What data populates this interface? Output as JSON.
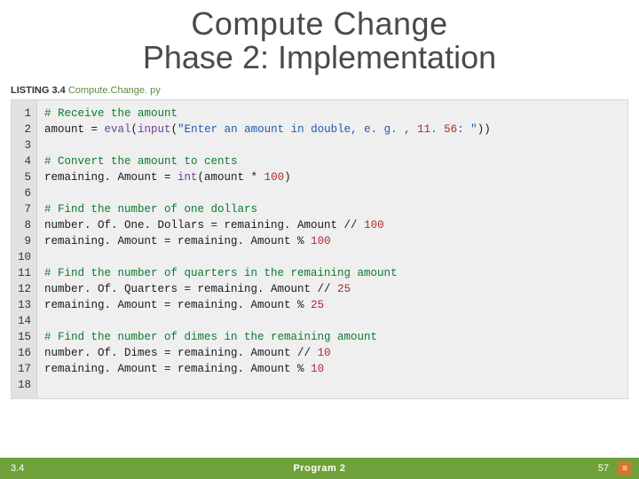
{
  "title": {
    "line1": "Compute Change",
    "line2": "Phase 2: Implementation"
  },
  "listing": {
    "label": "LISTING 3.4",
    "filename": "Compute.Change. py"
  },
  "code": {
    "lines": [
      {
        "n": "1",
        "t": "comment",
        "text": "# Receive the amount"
      },
      {
        "n": "2",
        "t": "code",
        "text": "amount = eval(input(\"Enter an amount in double, e. g. , 11. 56: \"))"
      },
      {
        "n": "3",
        "t": "blank",
        "text": ""
      },
      {
        "n": "4",
        "t": "comment",
        "text": "# Convert the amount to cents"
      },
      {
        "n": "5",
        "t": "code",
        "text": "remaining. Amount = int(amount * 100)"
      },
      {
        "n": "6",
        "t": "blank",
        "text": ""
      },
      {
        "n": "7",
        "t": "comment",
        "text": "# Find the number of one dollars"
      },
      {
        "n": "8",
        "t": "code",
        "text": "number. Of. One. Dollars = remaining. Amount // 100"
      },
      {
        "n": "9",
        "t": "code",
        "text": "remaining. Amount = remaining. Amount % 100"
      },
      {
        "n": "10",
        "t": "blank",
        "text": ""
      },
      {
        "n": "11",
        "t": "comment",
        "text": "# Find the number of quarters in the remaining amount"
      },
      {
        "n": "12",
        "t": "code",
        "text": "number. Of. Quarters = remaining. Amount // 25"
      },
      {
        "n": "13",
        "t": "code",
        "text": "remaining. Amount = remaining. Amount % 25"
      },
      {
        "n": "14",
        "t": "blank",
        "text": ""
      },
      {
        "n": "15",
        "t": "comment",
        "text": "# Find the number of dimes in the remaining amount"
      },
      {
        "n": "16",
        "t": "code",
        "text": "number. Of. Dimes = remaining. Amount // 10"
      },
      {
        "n": "17",
        "t": "code",
        "text": "remaining. Amount = remaining. Amount % 10"
      },
      {
        "n": "18",
        "t": "blank",
        "text": ""
      }
    ]
  },
  "footer": {
    "section": "3.4",
    "center": "Program 2",
    "page": "57",
    "icon": "≡"
  }
}
